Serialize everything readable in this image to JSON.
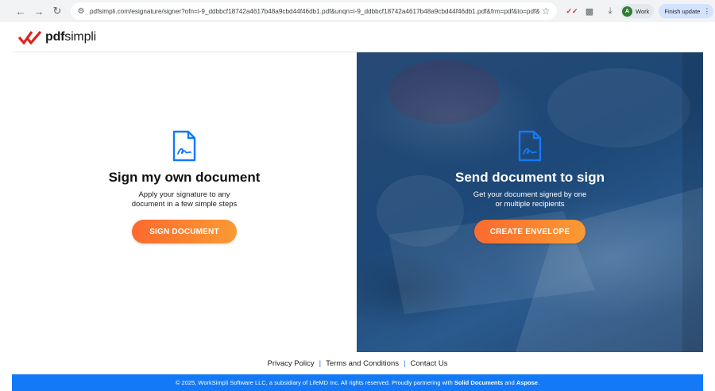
{
  "browser": {
    "url": "pdfsimpli.com/esignature/signer?ofn=i-9_ddbbcf18742a4617b48a9cbd44f46db1.pdf&unqn=i-9_ddbbcf18742a4617b48a9cbd44f46db1.pdf&frm=pdf&to=pdf&...",
    "profile_initial": "A",
    "profile_label": "Work",
    "finish_update_label": "Finish update"
  },
  "brand": {
    "logo_bold": "pdf",
    "logo_rest": "simpli",
    "accent_red": "#e0201b",
    "accent_blue": "#1479f6",
    "cta_orange": "#fb6a2e"
  },
  "left": {
    "icon": "signed-document-icon",
    "title": "Sign my own document",
    "desc_line1": "Apply your signature to any",
    "desc_line2": "document in a few simple steps",
    "button": "SIGN DOCUMENT"
  },
  "right": {
    "icon": "signed-document-icon",
    "title": "Send document to sign",
    "desc_line1": "Get your document signed by one",
    "desc_line2": "or multiple recipients",
    "button": "CREATE ENVELOPE"
  },
  "footer": {
    "links": [
      "Privacy Policy",
      "Terms and Conditions",
      "Contact Us"
    ],
    "separator": "|",
    "copyright_pre": "© 2025, WorkSimpli Software LLC, a subsidiary of LifeMD Inc. All rights reserved. Proudly partnering with ",
    "partner1": "Solid Documents",
    "and": " and ",
    "partner2": "Aspose",
    "period": "."
  }
}
